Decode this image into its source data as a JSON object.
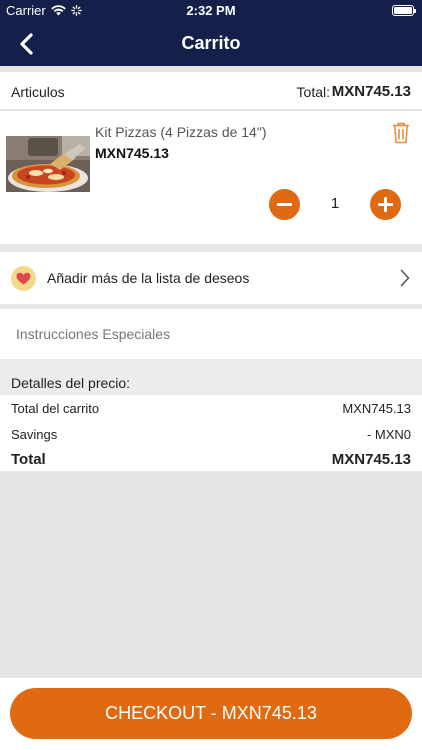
{
  "status_bar": {
    "carrier": "Carrier",
    "time": "2:32 PM"
  },
  "nav": {
    "title": "Carrito",
    "back_icon": "chevron-left-icon"
  },
  "cart": {
    "items_label": "Articulos",
    "total_label": "Total:",
    "total_value": "MXN745.13",
    "items": [
      {
        "name": "Kit Pizzas (4 Pizzas de 14\")",
        "price": "MXN745.13",
        "quantity": "1",
        "image_icon": "pizza-photo"
      }
    ]
  },
  "wishlist": {
    "label": "Añadir más de la lista de deseos",
    "icon": "heart-icon"
  },
  "instructions": {
    "placeholder": "Instrucciones Especiales",
    "value": ""
  },
  "price_details": {
    "title": "Detalles del precio:",
    "rows": [
      {
        "label": "Total del carrito",
        "value": "MXN745.13"
      },
      {
        "label": "Savings",
        "value": "- MXN0"
      },
      {
        "label": "Total",
        "value": "MXN745.13"
      }
    ]
  },
  "checkout": {
    "label": "CHECKOUT - MXN745.13"
  },
  "colors": {
    "nav_bg": "#15204a",
    "accent": "#e06a12",
    "page_bg": "#e6e6e6"
  }
}
